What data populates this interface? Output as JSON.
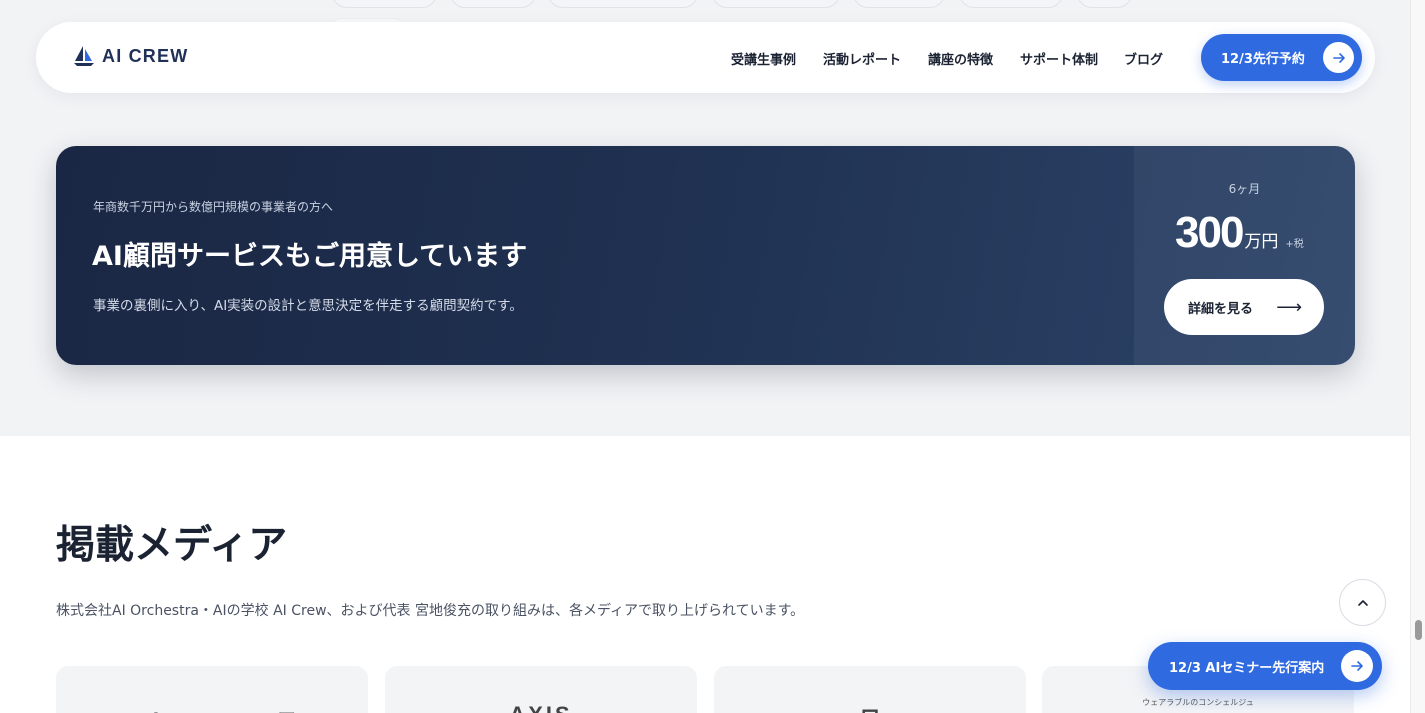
{
  "header": {
    "logo_text": "AI CREW",
    "nav": [
      {
        "label": "受講生事例"
      },
      {
        "label": "活動レポート"
      },
      {
        "label": "講座の特徴"
      },
      {
        "label": "サポート体制"
      },
      {
        "label": "ブログ"
      }
    ],
    "cta_label": "12/3先行予約"
  },
  "banner": {
    "subtitle": "年商数千万円から数億円規模の事業者の方へ",
    "title": "AI顧問サービスもご用意しています",
    "description": "事業の裏側に入り、AI実装の設計と意思決定を伴走する顧問契約です。",
    "price_period": "6ヶ月",
    "price_value": "300",
    "price_unit": "万円",
    "price_tax": "+税",
    "detail_button": "詳細を見る",
    "detail_arrow": "⟶"
  },
  "media": {
    "title": "掲載メディア",
    "description": "株式会社AI Orchestra・AIの学校 AI Crew、および代表 宮地俊充の取り組みは、各メディアで取り上げられています。",
    "cards": [
      {
        "logo": "Yahoo!ニュース"
      },
      {
        "logo": "AXIS"
      },
      {
        "logo": "日"
      },
      {
        "caption": "ウェアラブルのコンシェルジュ"
      }
    ]
  },
  "floating": {
    "seminar_label": "12/3 AIセミナー先行案内"
  },
  "colors": {
    "accent": "#2f6ae0",
    "banner_bg": "#1f3050",
    "text_dark": "#1b2333",
    "page_bg": "#f2f3f5"
  }
}
